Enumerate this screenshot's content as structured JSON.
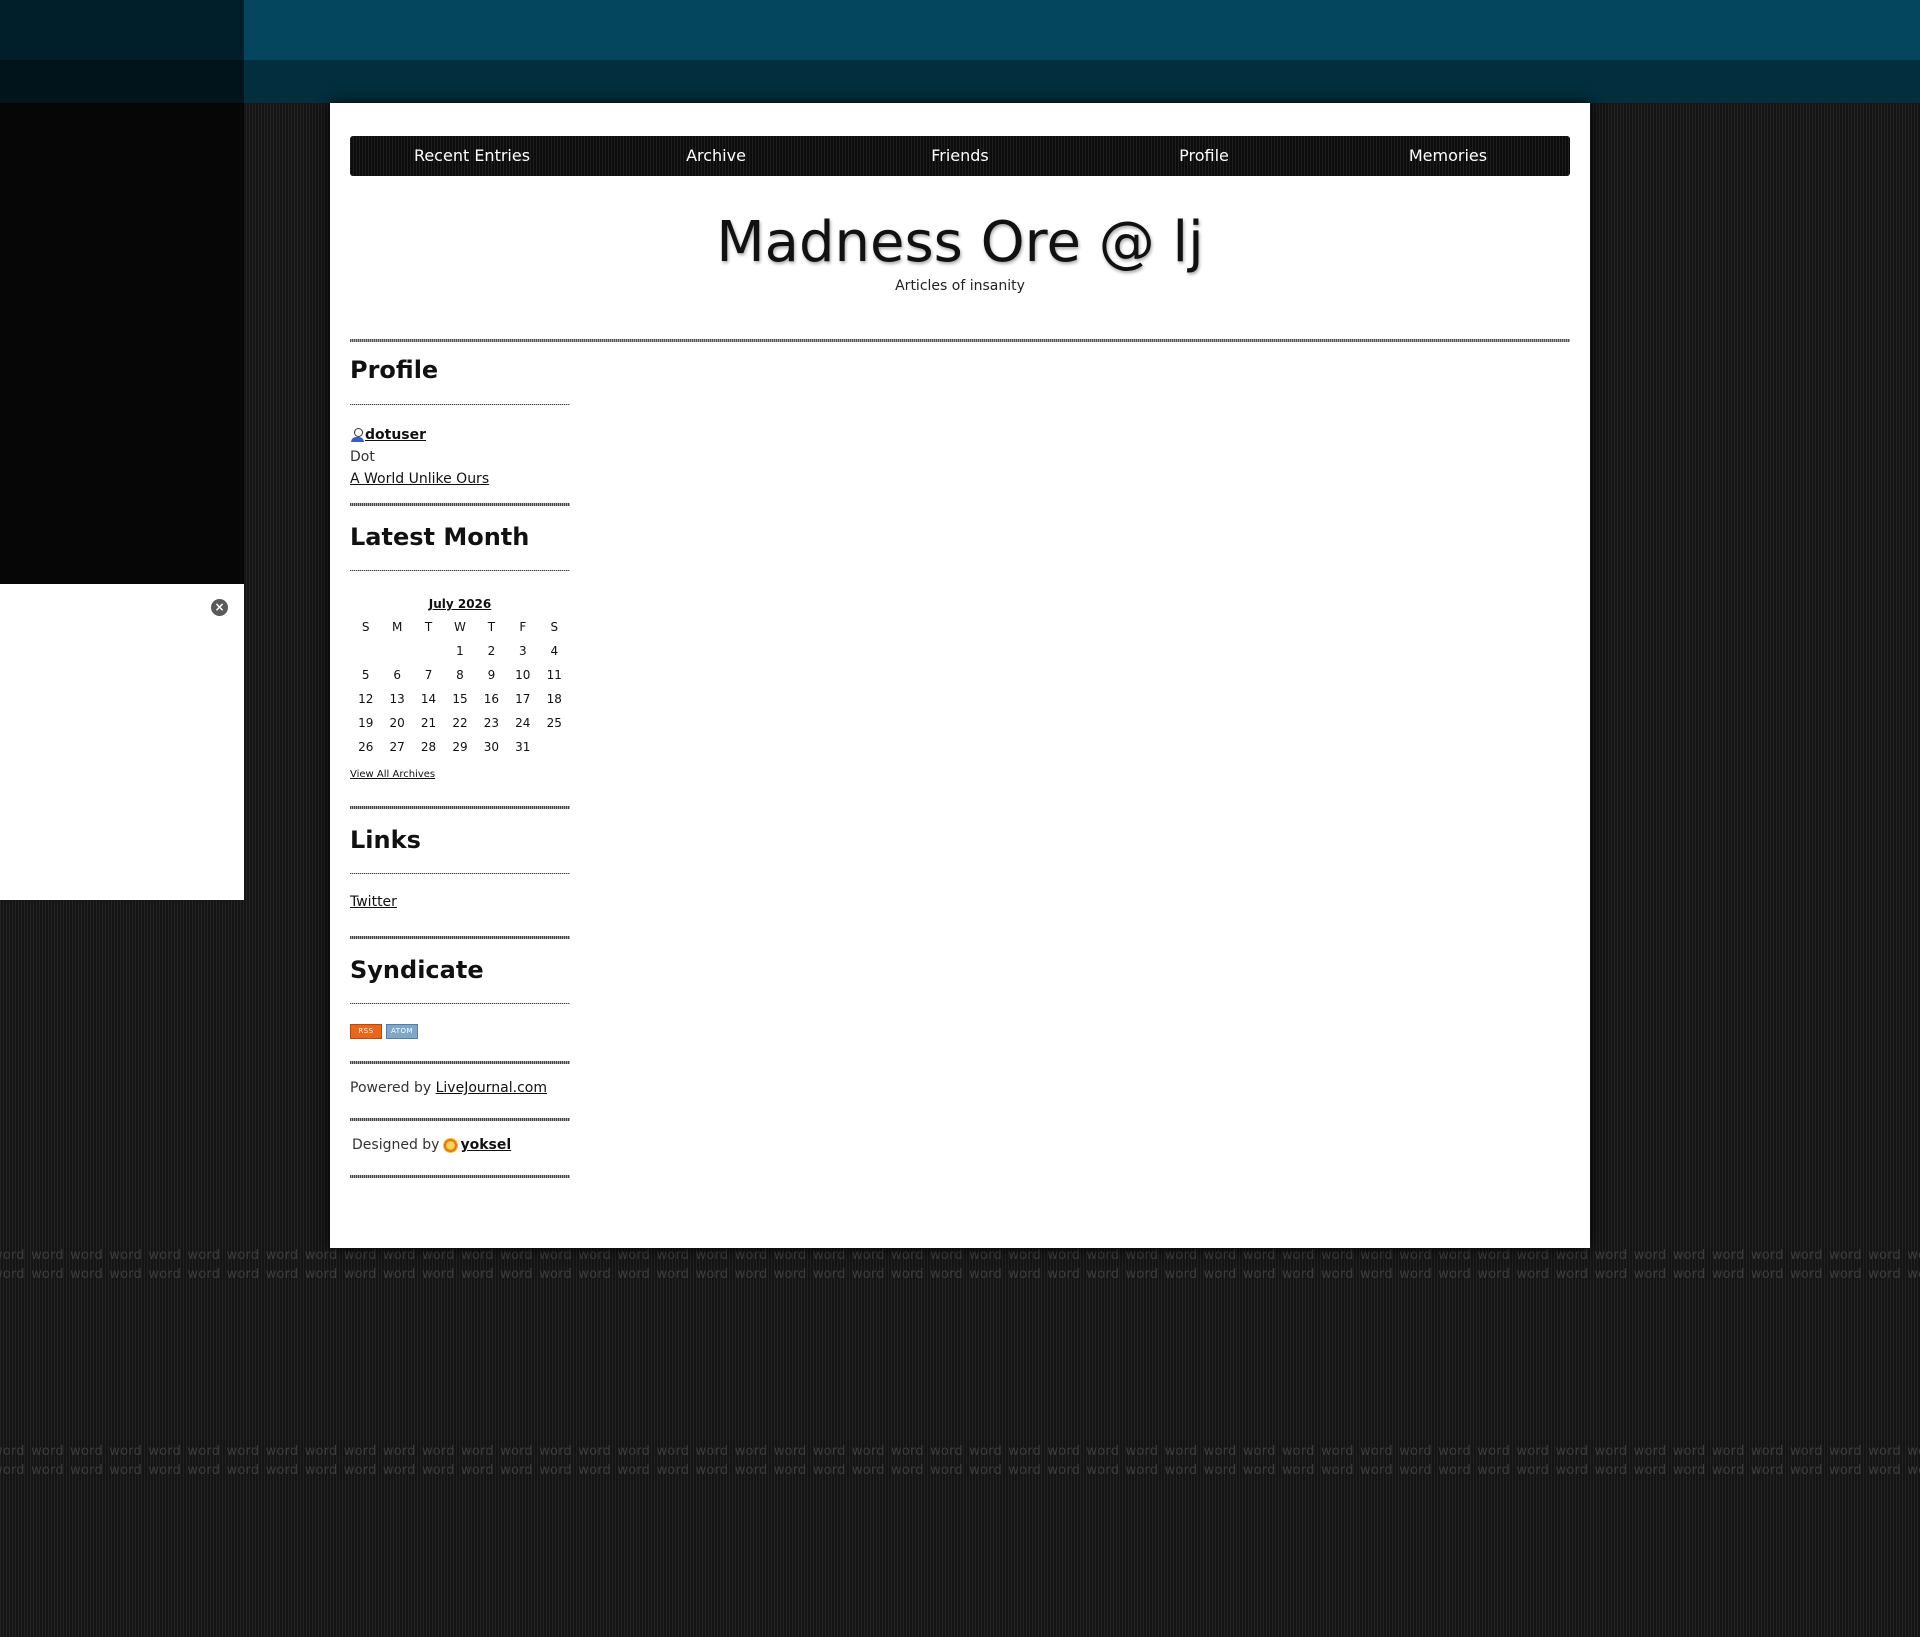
{
  "nav": {
    "items": [
      "Recent Entries",
      "Archive",
      "Friends",
      "Profile",
      "Memories"
    ]
  },
  "header": {
    "title": "Madness Ore @ lj",
    "subtitle": "Articles of insanity"
  },
  "profile": {
    "heading": "Profile",
    "username": "dotuser",
    "name": "Dot",
    "journal_link": "A World Unlike Ours"
  },
  "latest_month": {
    "heading": "Latest Month",
    "month_label": "July 2026",
    "weekdays": [
      "S",
      "M",
      "T",
      "W",
      "T",
      "F",
      "S"
    ],
    "weeks": [
      [
        "",
        "",
        "",
        "1",
        "2",
        "3",
        "4"
      ],
      [
        "5",
        "6",
        "7",
        "8",
        "9",
        "10",
        "11"
      ],
      [
        "12",
        "13",
        "14",
        "15",
        "16",
        "17",
        "18"
      ],
      [
        "19",
        "20",
        "21",
        "22",
        "23",
        "24",
        "25"
      ],
      [
        "26",
        "27",
        "28",
        "29",
        "30",
        "31",
        ""
      ]
    ],
    "view_all": "View All Archives"
  },
  "links": {
    "heading": "Links",
    "items": [
      "Twitter"
    ]
  },
  "syndicate": {
    "heading": "Syndicate",
    "rss_label": "RSS",
    "atom_label": "ATOM"
  },
  "footer": {
    "powered_prefix": "Powered by",
    "powered_link": "LiveJournal.com",
    "designed_prefix": "Designed by",
    "designer": "yoksel"
  },
  "background": {
    "watermark_word": "word",
    "accent_teal": "#04465d",
    "dark_teal": "#032e3d"
  },
  "icons": {
    "close": "close-icon",
    "user": "user-icon",
    "designer": "yoksel-userpic-icon"
  }
}
